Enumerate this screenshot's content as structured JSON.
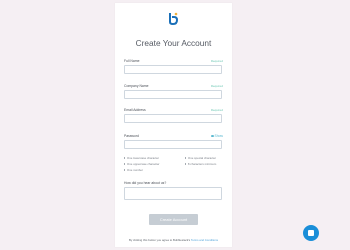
{
  "form": {
    "title": "Create Your Account",
    "fields": [
      {
        "label": "Full Name",
        "required": "Required"
      },
      {
        "label": "Company Name",
        "required": "Required"
      },
      {
        "label": "Email Address",
        "required": "Required"
      },
      {
        "label": "Password",
        "show": "Show"
      },
      {
        "label": "How did you hear about us?"
      }
    ],
    "password_requirements": [
      "One lowercase character",
      "One special character",
      "One uppercase character",
      "8 characters minimum",
      "One number"
    ],
    "submit_label": "Create Account",
    "terms_prefix": "By clicking this button you agree to Bubblestack's",
    "terms_link": "Terms and Conditions"
  },
  "colors": {
    "background": "#f5eff3",
    "accent": "#1a8ed8",
    "required": "#6fc8b4",
    "button_disabled": "#c6cdd4"
  },
  "icons": {
    "logo": "brand-logo-icon",
    "show_password": "eye-icon",
    "chat": "chat-icon"
  }
}
